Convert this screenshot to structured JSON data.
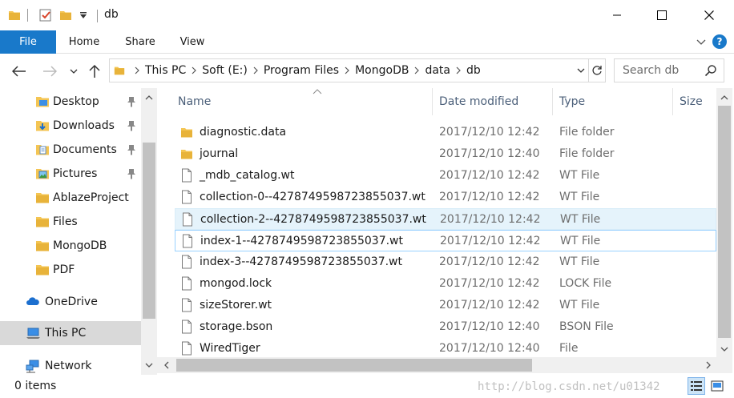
{
  "window": {
    "title": "db",
    "minimize_glyph": "—",
    "maximize_glyph": "☐",
    "close_glyph": "✕"
  },
  "ribbon": {
    "tabs": [
      "File",
      "Home",
      "Share",
      "View"
    ],
    "help_glyph": "?"
  },
  "address": {
    "crumbs": [
      "This PC",
      "Soft (E:)",
      "Program Files",
      "MongoDB",
      "data",
      "db"
    ]
  },
  "search": {
    "placeholder": "Search db"
  },
  "nav": {
    "items": [
      {
        "label": "Desktop",
        "icon": "desktop-icon",
        "pinned": true
      },
      {
        "label": "Downloads",
        "icon": "downloads-icon",
        "pinned": true
      },
      {
        "label": "Documents",
        "icon": "documents-icon",
        "pinned": true
      },
      {
        "label": "Pictures",
        "icon": "pictures-icon",
        "pinned": true
      },
      {
        "label": "AblazeProject",
        "icon": "folder-icon",
        "pinned": false
      },
      {
        "label": "Files",
        "icon": "folder-icon",
        "pinned": false
      },
      {
        "label": "MongoDB",
        "icon": "folder-icon",
        "pinned": false
      },
      {
        "label": "PDF",
        "icon": "folder-icon",
        "pinned": false
      },
      {
        "label": "OneDrive",
        "icon": "onedrive-icon",
        "pinned": false
      },
      {
        "label": "This PC",
        "icon": "this-pc-icon",
        "pinned": false,
        "selected": true
      },
      {
        "label": "Network",
        "icon": "network-icon",
        "pinned": false
      }
    ]
  },
  "columns": {
    "name": "Name",
    "date": "Date modified",
    "type": "Type",
    "size": "Size"
  },
  "files": [
    {
      "name": "diagnostic.data",
      "date": "2017/12/10 12:42",
      "type": "File folder",
      "kind": "folder"
    },
    {
      "name": "journal",
      "date": "2017/12/10 12:40",
      "type": "File folder",
      "kind": "folder"
    },
    {
      "name": "_mdb_catalog.wt",
      "date": "2017/12/10 12:42",
      "type": "WT File",
      "kind": "file"
    },
    {
      "name": "collection-0--4278749598723855037.wt",
      "date": "2017/12/10 12:42",
      "type": "WT File",
      "kind": "file"
    },
    {
      "name": "collection-2--4278749598723855037.wt",
      "date": "2017/12/10 12:42",
      "type": "WT File",
      "kind": "file",
      "state": "hover"
    },
    {
      "name": "index-1--4278749598723855037.wt",
      "date": "2017/12/10 12:42",
      "type": "WT File",
      "kind": "file",
      "state": "focus"
    },
    {
      "name": "index-3--4278749598723855037.wt",
      "date": "2017/12/10 12:42",
      "type": "WT File",
      "kind": "file"
    },
    {
      "name": "mongod.lock",
      "date": "2017/12/10 12:42",
      "type": "LOCK File",
      "kind": "file"
    },
    {
      "name": "sizeStorer.wt",
      "date": "2017/12/10 12:42",
      "type": "WT File",
      "kind": "file"
    },
    {
      "name": "storage.bson",
      "date": "2017/12/10 12:40",
      "type": "BSON File",
      "kind": "file"
    },
    {
      "name": "WiredTiger",
      "date": "2017/12/10 12:40",
      "type": "File",
      "kind": "file"
    }
  ],
  "status": {
    "items": "0 items",
    "watermark": "http://blog.csdn.net/u01342"
  },
  "colors": {
    "accent": "#1979ca",
    "folder": "#f4c553",
    "hover_row": "#e5f3fb",
    "selected_nav": "#d9d9d9"
  }
}
